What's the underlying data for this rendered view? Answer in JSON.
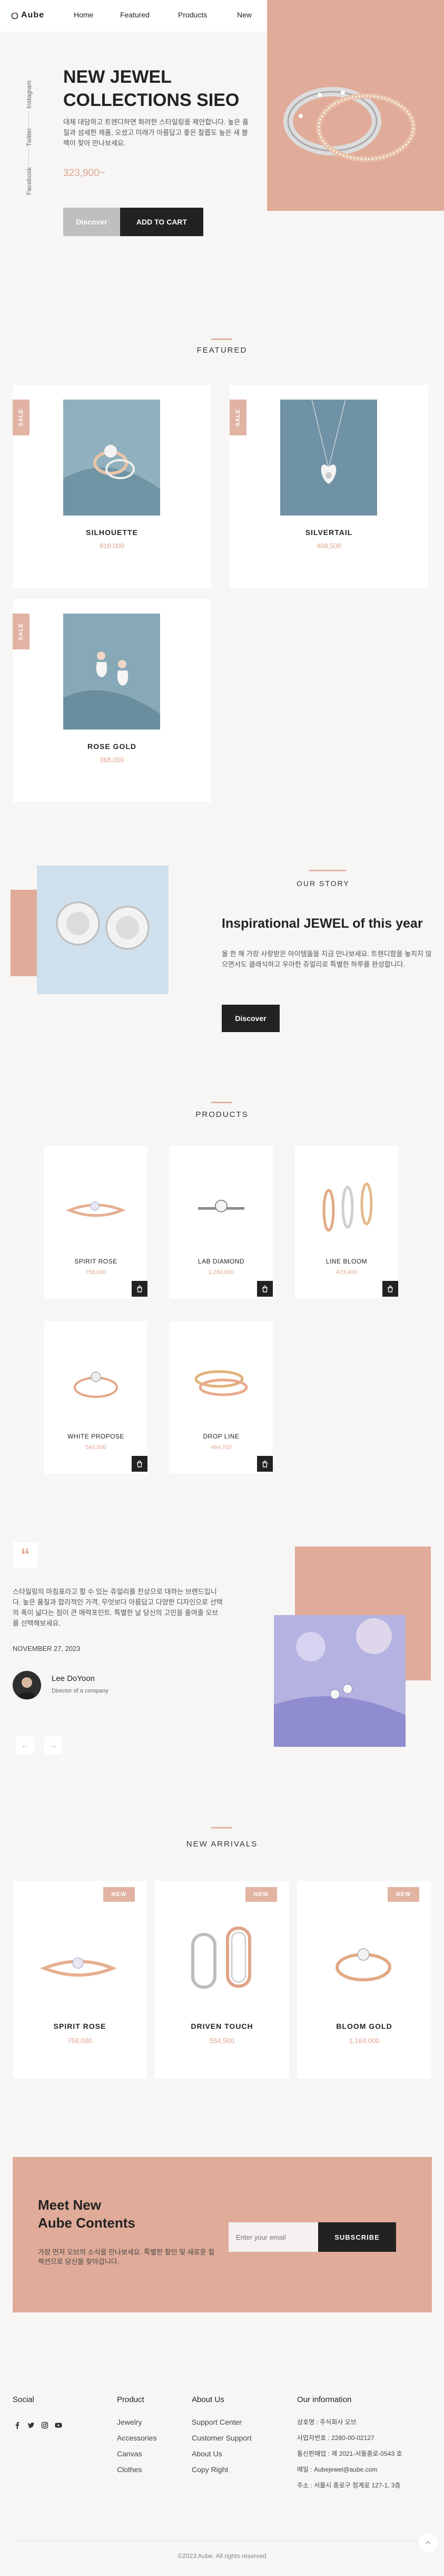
{
  "header": {
    "logo": "Aube",
    "nav": [
      "Home",
      "Featured",
      "Products",
      "New"
    ]
  },
  "hero": {
    "social": [
      "Instagram",
      "Twitter",
      "Facebook"
    ],
    "title_line1": "NEW JEWEL",
    "title_line2": "COLLECTIONS SIEO",
    "description": "대체 대담하고 트렌디하면 화려한 스타일링을 제안합니다. 높은 품질과 섬세한 제품, 오셨고 미래가 아름답고 좋은 찰릅도 높은 새 블랙이 찾아 만나보세요.",
    "price": "323,900",
    "price_unit": "~",
    "discover_label": "Discover",
    "cart_label": "ADD TO CART"
  },
  "featured": {
    "title": "FEATURED",
    "badge": "SALE",
    "items": [
      {
        "name": "SILHOUETTE",
        "price": "918,000"
      },
      {
        "name": "SILVERTAIL",
        "price": "408,500"
      },
      {
        "name": "ROSE GOLD",
        "price": "368,000"
      }
    ]
  },
  "story": {
    "label": "OUR STORY",
    "title": "Inspirational JEWEL of this year",
    "description": "올 한 해 가장 사랑받은 아이템들을 지금 만나보세요. 트렌디함을 놓치지 않으면서도 클래식하고 우아한 쥬얼리로 특별한 하루를 완성합니다.",
    "button": "Discover"
  },
  "products": {
    "title": "PRODUCTS",
    "items": [
      {
        "name": "SPIRIT ROSE",
        "price": "758,000"
      },
      {
        "name": "LAB DIAMOND",
        "price": "1,260,000"
      },
      {
        "name": "LINE BLOOM",
        "price": "473,400"
      },
      {
        "name": "WHITE PROPOSE",
        "price": "540,000"
      },
      {
        "name": "DROP LINE",
        "price": "464,700"
      }
    ]
  },
  "testimonial": {
    "quote_mark": "“",
    "text": "스타일링의 마침표라고 할 수 있는 쥬얼리를 찬상으로 대하는 브랜드입니다. 높은 품질과 합리적인 가격, 무엇보다 아름답고 다양한 디자인으로 선택의 폭이 넓다는 점이 큰 매력포인트. 특별한 날 당신의 고민을 줄여줄 오브를 선택해보세요.",
    "date": "NOVEMBER 27, 2023",
    "author": "Lee DoYoon",
    "role": "Director of a company",
    "prev": "←",
    "next": "→"
  },
  "new_arrivals": {
    "title": "NEW ARRIVALS",
    "badge": "NEW",
    "items": [
      {
        "name": "SPIRIT ROSE",
        "price": "758,000"
      },
      {
        "name": "DRIVEN TOUCH",
        "price": "554,500"
      },
      {
        "name": "BLOOM GOLD",
        "price": "1,164,000"
      }
    ]
  },
  "newsletter": {
    "title_line1": "Meet New",
    "title_line2": "Aube Contents",
    "description": "가장 먼저 오브의 소식을 만나보세요. 특별한 할인 및 새로운 컬렉션으로 당신을 찾아갑니다.",
    "placeholder": "Enter your email",
    "button": "SUBSCRIBE"
  },
  "footer": {
    "social_title": "Social",
    "product_title": "Product",
    "product_links": [
      "Jewelry",
      "Accessories",
      "Canvas",
      "Clothes"
    ],
    "about_title": "About Us",
    "about_links": [
      "Support Center",
      "Customer Support",
      "About Us",
      "Copy Right"
    ],
    "info_title": "Our information",
    "info_lines": [
      "상호명 : 주식회사 오브",
      "사업자번호 : 2280-00-02127",
      "통신판매업 : 제 2021-서울종로-0543 호",
      "메일 : Aubejewel@aube.com",
      "주소 : 서울시 종로구 청계로 127-1, 3층"
    ],
    "copyright": "©2023 Aube. All rights reserved"
  },
  "colors": {
    "accent": "#e2b3a3",
    "dark": "#222222",
    "background": "#f7f6f5"
  }
}
